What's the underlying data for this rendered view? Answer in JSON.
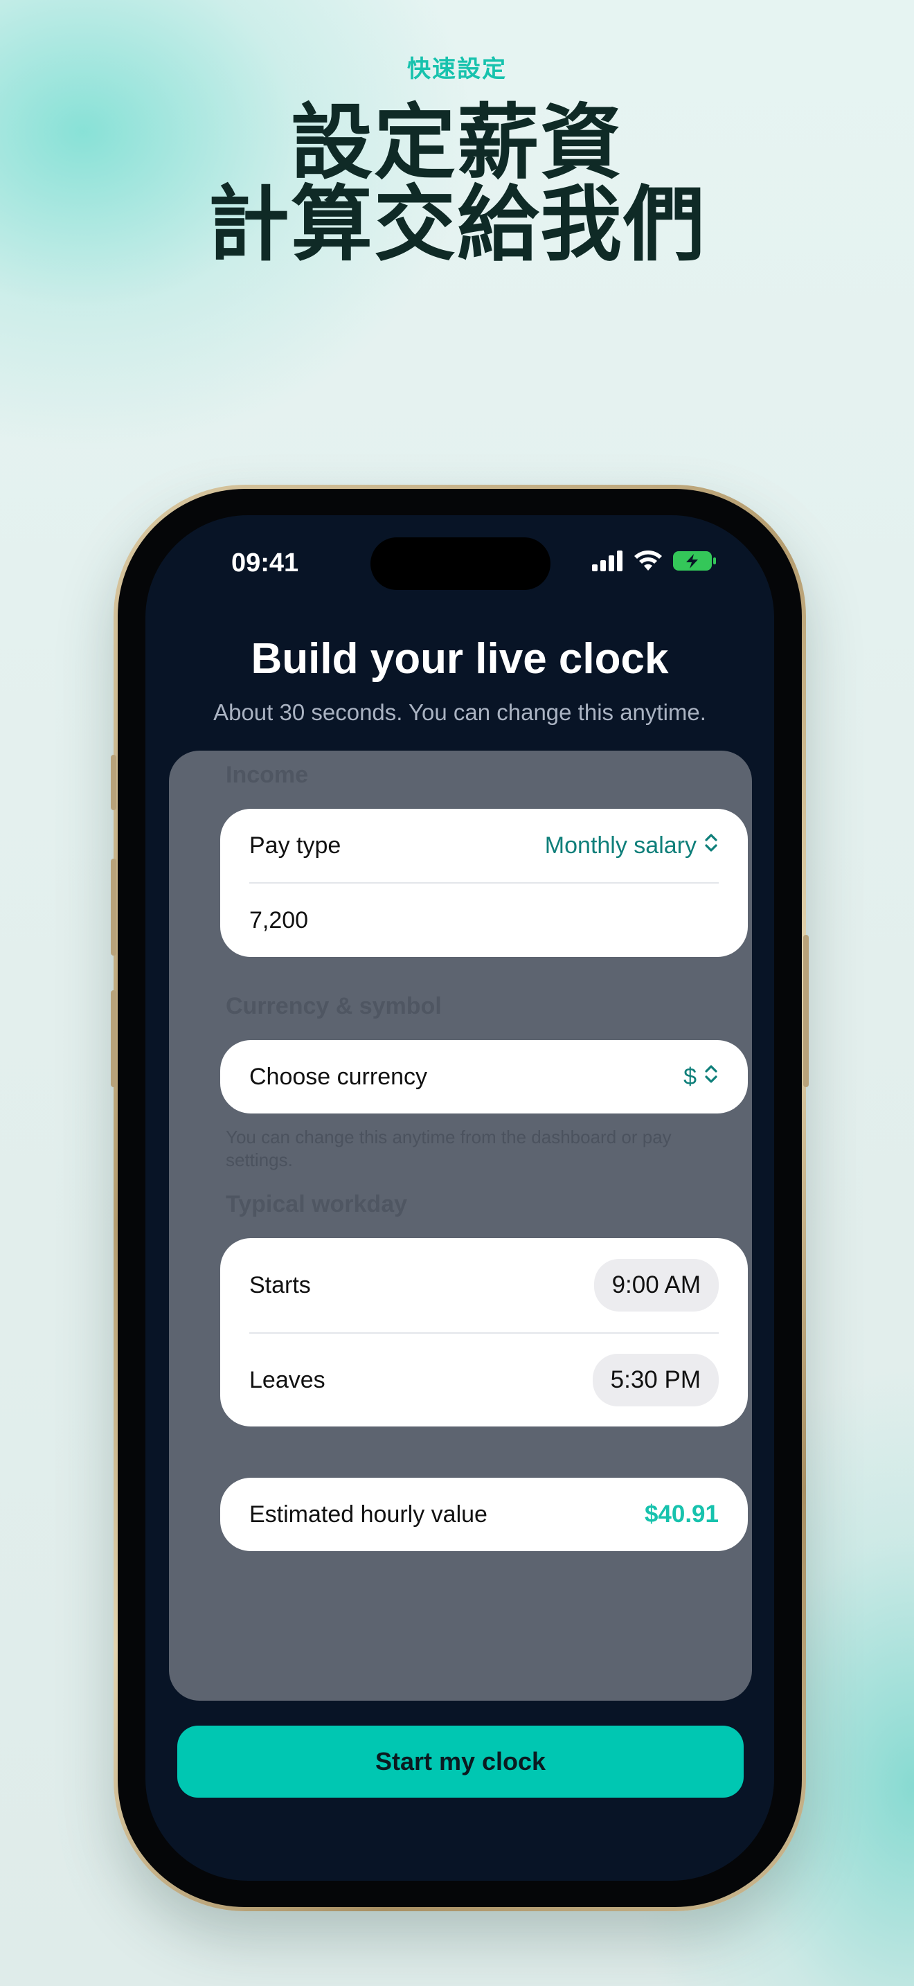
{
  "hero": {
    "eyebrow": "快速設定",
    "headline_line1": "設定薪資",
    "headline_line2": "計算交給我們"
  },
  "status_bar": {
    "time": "09:41",
    "icons": [
      "cellular-signal-icon",
      "wifi-icon",
      "battery-charging-icon"
    ],
    "battery_color": "#34c759"
  },
  "screen": {
    "title": "Build your live clock",
    "subtitle": "About 30 seconds. You can change this anytime."
  },
  "income": {
    "section_label": "Income",
    "pay_type_label": "Pay type",
    "pay_type_value": "Monthly salary",
    "amount_value": "7,200"
  },
  "currency": {
    "section_label": "Currency & symbol",
    "choose_label": "Choose currency",
    "symbol": "$",
    "helper_text": "You can change this anytime from the dashboard or pay settings."
  },
  "workday": {
    "section_label": "Typical workday",
    "starts_label": "Starts",
    "starts_value": "9:00 AM",
    "leaves_label": "Leaves",
    "leaves_value": "5:30 PM"
  },
  "estimate": {
    "label": "Estimated hourly value",
    "value": "$40.91"
  },
  "cta": {
    "label": "Start my clock"
  },
  "colors": {
    "accent": "#17c2ad",
    "cta_background": "#00c7b2",
    "screen_background": "#081426",
    "headline": "#0f2a26"
  }
}
